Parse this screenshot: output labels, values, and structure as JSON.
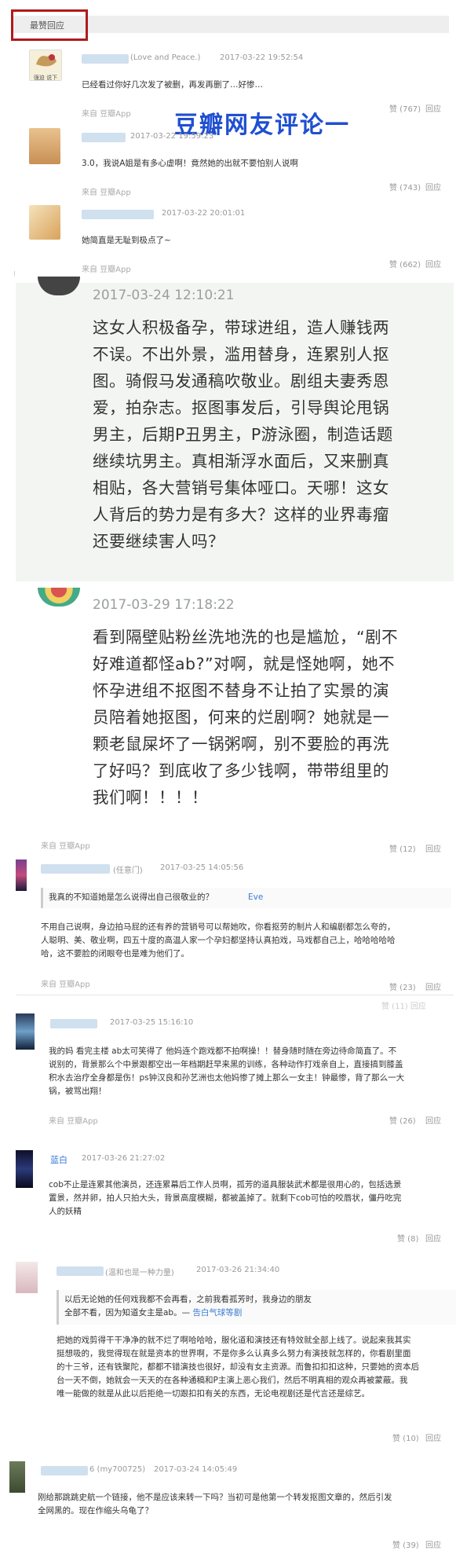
{
  "header": {
    "label": "最赞回应"
  },
  "overlay_title": "豆瓣网友评论一",
  "comments_top": [
    {
      "user_suffix": "(Love and Peace.)",
      "time": "2017-03-22 19:52:54",
      "text": "已经看过你好几次发了被删，再发再删了…好惨…",
      "source": "来自 豆瓣App",
      "likes": "赞 (767)",
      "reply": "回应",
      "avatar_caption": "强迫  说下"
    },
    {
      "user_suffix": "",
      "time": "2017-03-22 19:59:23",
      "text": "3.0，我说A姐是有多心虚啊！竟然她的出就不要怕别人说啊",
      "source": "来自 豆瓣App",
      "likes": "赞 (743)",
      "reply": "回应"
    },
    {
      "user_suffix": "",
      "time": "2017-03-22 20:01:01",
      "text": "她简直是无耻到极点了~",
      "source": "来自 豆瓣App",
      "likes": "赞 (662)",
      "reply": "回应"
    }
  ],
  "big_posts": [
    {
      "time": "2017-03-24 12:10:21",
      "lines": [
        "这女人积极备孕，带球进组，造人赚钱两",
        "不误。不出外景，滥用替身，连累别人抠",
        "图。骑假马发通稿吹敬业。剧组夫妻秀恩",
        "爱，拍杂志。抠图事发后，引导舆论甩锅",
        "男主，后期P丑男主，P游泳圈，制造话题",
        "继续坑男主。真相渐浮水面后，又来删真",
        "相贴，各大营销号集体哑口。天哪！这女",
        "人背后的势力是有多大？这样的业界毒瘤",
        "还要继续害人吗？"
      ]
    },
    {
      "time": "2017-03-29 17:18:22",
      "lines": [
        "看到隔壁贴粉丝洗地洗的也是尴尬，“剧不",
        "好难道都怪ab?”对啊，就是怪她啊，她不",
        "怀孕进组不抠图不替身不让拍了实景的演",
        "员陪着她抠图，何来的烂剧啊？她就是一",
        "颗老鼠屎坏了一锅粥啊，别不要脸的再洗",
        "了好吗？到底收了多少钱啊，带带组里的",
        "我们啊！！！！"
      ],
      "source": "来自 豆瓣App",
      "likes": "赞 (12)",
      "reply": "回应"
    }
  ],
  "comments_mid": [
    {
      "user_suffix": "(任意门)",
      "time": "2017-03-25 14:05:56",
      "quote": "我真的不知道她是怎么说得出自己很敬业的？",
      "quote_user": "Eve",
      "lines": [
        "不用自己说啊，身边拍马屁的还有养的营销号可以帮她吹，你看抠劳的制片人和编剧都怎么夸的，",
        "人聪明、美、敬业啊，四五十度的高温人家一个孕妇都坚持认真拍戏，马戏都自己上，哈哈哈哈哈",
        "哈，这不要脸的闭眼夸也是难为他们了。"
      ],
      "source": "来自 豆瓣App",
      "likes": "赞 (23)",
      "reply": "回应",
      "extra_likes": "赞 (11)   回应"
    },
    {
      "user_suffix": "",
      "time": "2017-03-25 15:16:10",
      "lines": [
        "我的妈 看完主楼 ab太可笑得了 他妈连个跑戏都不拍啊操！！替身随时随在旁边待命简直了。不",
        "说别的，背景那么个中景跟都空出一年档期赶早来黑的训练，各种动作打戏亲自上，直接搞到膝盖",
        "积水去治疗全身都是伤！ps钟汉良和孙艺洲也太他妈惨了摊上那么一女主！钟最惨，背了那么一大",
        "锅，被骂出翔！"
      ],
      "source": "来自 豆瓣App",
      "likes": "赞 (26)",
      "reply": "回应"
    },
    {
      "user_name": "蓝白",
      "time": "2017-03-26 21:27:02",
      "lines": [
        "cob不止是连累其他演员，还连累幕后工作人员啊，孤芳的道具服装武术都是很用心的，包括选景",
        "置景，然并卵，拍人只拍大头，背景高度模糊，都被盖掉了。就剩下cob可怕的咬唇状，僵丹吃完",
        "人的妖精"
      ],
      "likes": "赞 (8)",
      "reply": "回应"
    },
    {
      "user_suffix": "(温和也是一种力量)",
      "time": "2017-03-26 21:34:40",
      "quote_lines": [
        "以后无论她的任何戏我都不会再看，之前我看孤芳时，我身边的朋友",
        "全部不看，因为知道女主是ab。— "
      ],
      "quote_user": "告白气球等剧",
      "lines": [
        "把她的戏剪得干干净净的就不烂了啊哈哈哈，服化道和演技还有特效就全部上线了。说起来我其实",
        "挺想吸的，我觉得现在就是资本的世界啊，不是你多么认真多么努力有演技就怎样的，你看剧里面",
        "的十三爷，还有铁聚陀，都都不错演技也很好，却没有女主资源。而鲁扣扣扣这种，只要她的资本后",
        "台一天不倒，她就会一天天的在各种通稿和P主演上恶心我们，然后不明真相的观众再被蒙蔽。我",
        "唯一能做的就是从此以后拒绝一切跟扣扣有关的东西，无论电视剧还是代言还是综艺。"
      ],
      "likes": "赞 (10)",
      "reply": "回应"
    },
    {
      "user_suffix": "6 (my700725)",
      "time": "2017-03-24 14:05:49",
      "lines": [
        "刚给那跳跳史航一个链接，他不是应该来转一下吗？当初可是他第一个转发抠图文章的，然后引发",
        "全网黑的。现在作缩头乌龟了？"
      ],
      "likes": "赞 (39)",
      "reply": "回应"
    }
  ],
  "colors": {
    "accent_box": "#b01a1a",
    "overlay": "#1f4fd1",
    "quote_user": "#3a7bd5"
  }
}
